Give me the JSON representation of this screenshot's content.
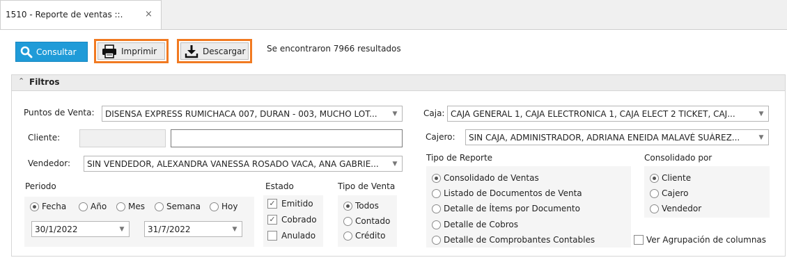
{
  "tab": {
    "title": "1510 - Reporte de ventas ::.",
    "close": "×"
  },
  "toolbar": {
    "consultar": "Consultar",
    "imprimir": "Imprimir",
    "descargar": "Descargar",
    "results": "Se encontraron 7966 resultados"
  },
  "filters": {
    "title": "Filtros",
    "puntos_label": "Puntos de Venta:",
    "puntos_value": "DISENSA EXPRESS RUMICHACA 007, DURAN - 003, MUCHO LOT...",
    "cliente_label": "Cliente:",
    "cliente_code": "",
    "cliente_name": "",
    "vendedor_label": "Vendedor:",
    "vendedor_value": "SIN VENDEDOR, ALEXANDRA VANESSA ROSADO VACA, ANA GABRIE...",
    "periodo_label": "Periodo",
    "periodo_options": [
      "Fecha",
      "Año",
      "Mes",
      "Semana",
      "Hoy"
    ],
    "periodo_selected": "Fecha",
    "fecha_desde": "30/1/2022",
    "fecha_hasta": "31/7/2022",
    "estado_label": "Estado",
    "estado_options": [
      {
        "label": "Emitido",
        "checked": true
      },
      {
        "label": "Cobrado",
        "checked": true
      },
      {
        "label": "Anulado",
        "checked": false
      }
    ],
    "tipo_venta_label": "Tipo de Venta",
    "tipo_venta_options": [
      "Todos",
      "Contado",
      "Crédito"
    ],
    "tipo_venta_selected": "Todos",
    "caja_label": "Caja:",
    "caja_value": "CAJA GENERAL 1, CAJA ELECTRONICA 1, CAJA ELECT 2 TICKET, CAJ...",
    "cajero_label": "Cajero:",
    "cajero_value": "SIN CAJA, ADMINISTRADOR, ADRIANA ENEIDA MALAVÉ SUÁREZ...",
    "tipo_reporte_label": "Tipo de Reporte",
    "tipo_reporte_options": [
      "Consolidado de Ventas",
      "Listado de Documentos de Venta",
      "Detalle de Ítems por Documento",
      "Detalle de Cobros",
      "Detalle de Comprobantes Contables"
    ],
    "tipo_reporte_selected": "Consolidado de Ventas",
    "consolidado_label": "Consolidado por",
    "consolidado_options": [
      "Cliente",
      "Cajero",
      "Vendedor"
    ],
    "consolidado_selected": "Cliente",
    "agrupacion_label": "Ver Agrupación de columnas",
    "agrupacion_checked": false
  },
  "colors": {
    "accent": "#1f9bd8",
    "highlight": "#f17a21"
  },
  "icons": {
    "consultar": "search-icon",
    "imprimir": "printer-icon",
    "descargar": "download-icon"
  }
}
